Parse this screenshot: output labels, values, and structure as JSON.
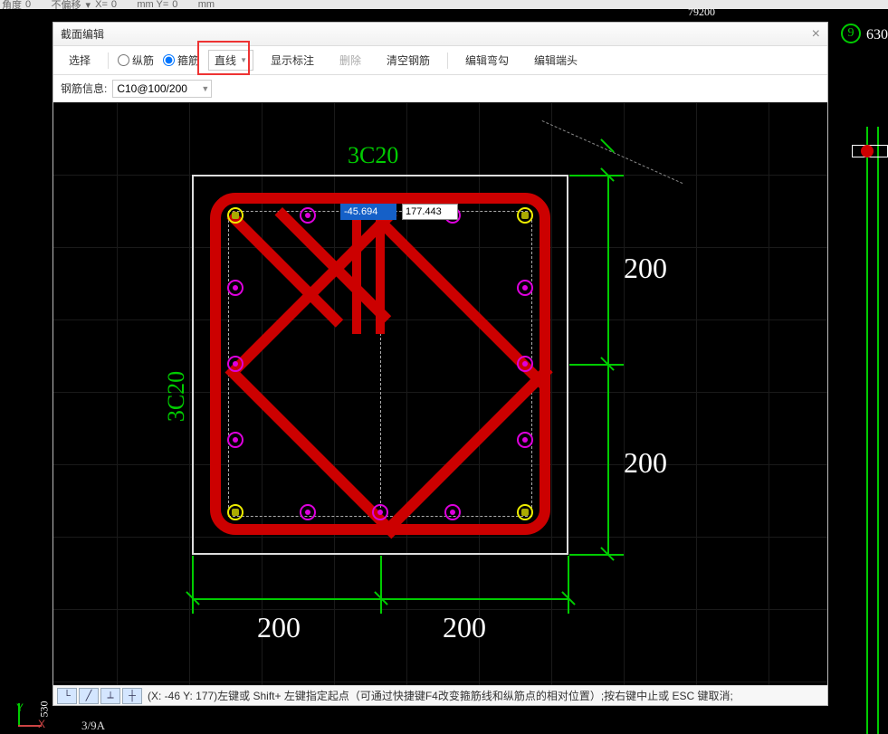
{
  "outer_toolbar": {
    "angle_label": "角度",
    "angle_val": "0",
    "offset_label": "不偏移",
    "x_label": "X=",
    "x_val": "0",
    "y_label": "mm Y=",
    "y_val": "0",
    "mm": "mm"
  },
  "dialog": {
    "title": "截面编辑",
    "close": "×",
    "toolbar": {
      "select": "选择",
      "radio1": "纵筋",
      "radio2": "箍筋",
      "line_btn": "直线",
      "show_label": "显示标注",
      "delete": "删除",
      "clear": "清空钢筋",
      "edit_hook": "编辑弯勾",
      "edit_end": "编辑端头"
    },
    "infobar": {
      "label": "钢筋信息:",
      "value": "C10@100/200"
    },
    "canvas": {
      "top_label": "3C20",
      "left_label": "3C20",
      "dim_right_1": "200",
      "dim_right_2": "200",
      "dim_bottom_1": "200",
      "dim_bottom_2": "200",
      "coord_x": "-45.694",
      "coord_y": "177.443"
    },
    "status": {
      "text": "(X: -46 Y: 177)左键或 Shift+ 左键指定起点（可通过快捷键F4改变箍筋线和纵筋点的相对位置）;按右键中止或 ESC 键取消;"
    }
  },
  "outside": {
    "num630": "630",
    "circ9": "9",
    "top_num": "79200",
    "side_530": "530",
    "side_390a": "3/9A"
  }
}
